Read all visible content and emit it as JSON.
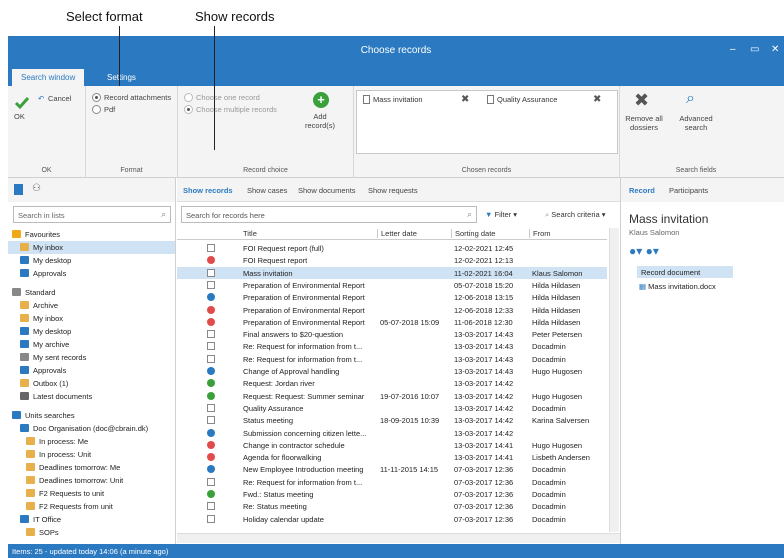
{
  "callouts": {
    "select_format": "Select format",
    "show_records": "Show records"
  },
  "window": {
    "title": "Choose records",
    "minimize": "‒",
    "maximize": "▭",
    "close": "✕"
  },
  "ribbon": {
    "tabs": [
      "Search window",
      "Settings"
    ],
    "ok": "OK",
    "cancel": "Cancel",
    "group_ok": "OK",
    "format": {
      "option1": "Record attachments",
      "option2": "Pdf",
      "label": "Format"
    },
    "record_choice": {
      "option1": "Choose one record",
      "option2": "Choose multiple records",
      "add": "Add record(s)",
      "label": "Record choice"
    },
    "chosen": {
      "item1": "Mass invitation",
      "item2": "Quality Assurance",
      "label": "Chosen records"
    },
    "remove_all": "Remove all dossiers",
    "advanced": "Advanced search",
    "search_fields": "Search fields"
  },
  "left": {
    "search_placeholder": "Search in lists",
    "tree": [
      "Favourites",
      "My inbox",
      "My desktop",
      "Approvals",
      "Standard",
      "Archive",
      "My inbox",
      "My desktop",
      "My archive",
      "My sent records",
      "Approvals",
      "Outbox (1)",
      "Latest documents",
      "Units searches",
      "Doc Organisation (doc@cbrain.dk)",
      "In process: Me",
      "In process: Unit",
      "Deadlines tomorrow: Me",
      "Deadlines tomorrow: Unit",
      "F2 Requests to unit",
      "F2 Requests from unit",
      "IT Office",
      "SOPs"
    ]
  },
  "center": {
    "tabs": [
      "Show records",
      "Show cases",
      "Show documents",
      "Show requests"
    ],
    "search_placeholder": "Search for records here",
    "filter": "Filter",
    "search_criteria": "Search criteria",
    "headers": {
      "title": "Title",
      "letter_date": "Letter date",
      "sorting_date": "Sorting date",
      "from": "From"
    },
    "rows": [
      {
        "title": "FOI Request report (full)",
        "letter": "",
        "sort": "12-02-2021 12:45",
        "from": ""
      },
      {
        "title": "FOI Request report",
        "letter": "",
        "sort": "12-02-2021 12:13",
        "from": ""
      },
      {
        "title": "Mass invitation",
        "letter": "",
        "sort": "11-02-2021 16:04",
        "from": "Klaus Salomon"
      },
      {
        "title": "Preparation of Environmental Report",
        "letter": "",
        "sort": "05-07-2018 15:20",
        "from": "Hilda Hildasen"
      },
      {
        "title": "Preparation of Environmental Report",
        "letter": "",
        "sort": "12-06-2018 13:15",
        "from": "Hilda Hildasen"
      },
      {
        "title": "Preparation of Environmental Report",
        "letter": "",
        "sort": "12-06-2018 12:33",
        "from": "Hilda Hildasen"
      },
      {
        "title": "Preparation of Environmental Report",
        "letter": "05-07-2018 15:09",
        "sort": "11-06-2018 12:30",
        "from": "Hilda Hildasen"
      },
      {
        "title": "Final answers to $20-question",
        "letter": "",
        "sort": "13-03-2017 14:43",
        "from": "Peter Petersen"
      },
      {
        "title": "Re: Request for information from t...",
        "letter": "",
        "sort": "13-03-2017 14:43",
        "from": "Docadmin"
      },
      {
        "title": "Re: Request for information from t...",
        "letter": "",
        "sort": "13-03-2017 14:43",
        "from": "Docadmin"
      },
      {
        "title": "Change of Approval handling",
        "letter": "",
        "sort": "13-03-2017 14:43",
        "from": "Hugo Hugosen"
      },
      {
        "title": "Request: Jordan river",
        "letter": "",
        "sort": "13-03-2017 14:42",
        "from": ""
      },
      {
        "title": "Request: Request: Summer seminar",
        "letter": "19-07-2016 10:07",
        "sort": "13-03-2017 14:42",
        "from": "Hugo Hugosen"
      },
      {
        "title": "Quality Assurance",
        "letter": "",
        "sort": "13-03-2017 14:42",
        "from": "Docadmin"
      },
      {
        "title": "Status meeting",
        "letter": "18-09-2015 10:39",
        "sort": "13-03-2017 14:42",
        "from": "Karina Salversen"
      },
      {
        "title": "Submission concerning citizen lette...",
        "letter": "",
        "sort": "13-03-2017 14:42",
        "from": ""
      },
      {
        "title": "Change in contractor schedule",
        "letter": "",
        "sort": "13-03-2017 14:41",
        "from": "Hugo Hugosen"
      },
      {
        "title": "Agenda for floorwalking",
        "letter": "",
        "sort": "13-03-2017 14:41",
        "from": "Lisbeth Andersen"
      },
      {
        "title": "New Employee Introduction meeting",
        "letter": "11-11-2015 14:15",
        "sort": "07-03-2017 12:36",
        "from": "Docadmin"
      },
      {
        "title": "Re: Request for information from t...",
        "letter": "",
        "sort": "07-03-2017 12:36",
        "from": "Docadmin"
      },
      {
        "title": "Fwd.: Status meeting",
        "letter": "",
        "sort": "07-03-2017 12:36",
        "from": "Docadmin"
      },
      {
        "title": "Re: Status meeting",
        "letter": "",
        "sort": "07-03-2017 12:36",
        "from": "Docadmin"
      },
      {
        "title": "Holiday calendar update",
        "letter": "",
        "sort": "07-03-2017 12:36",
        "from": "Docadmin"
      }
    ]
  },
  "right": {
    "tabs": [
      "Record",
      "Participants"
    ],
    "title": "Mass invitation",
    "subtitle": "Klaus Salomon",
    "record_document": "Record document",
    "attachment": "Mass invitation.docx"
  },
  "status": "Items: 25 - updated today 14:06 (a minute ago)",
  "colors": {
    "accent": "#2b7ac1",
    "selected": "#cfe3f5"
  }
}
